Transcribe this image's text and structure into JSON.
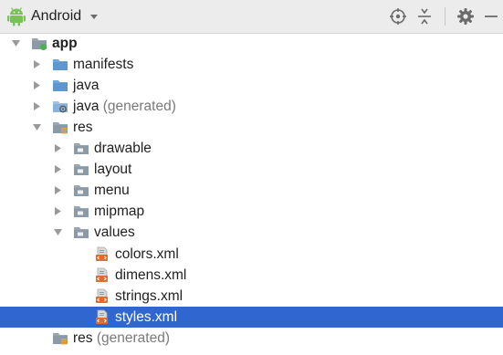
{
  "toolbar": {
    "view_label": "Android",
    "icons": [
      "android-icon",
      "chevron-down-icon",
      "locate-icon",
      "collapse-all-icon",
      "gear-icon",
      "minimize-icon"
    ]
  },
  "colors": {
    "selection": "#2f66d0",
    "folder_blue": "#6fa6d8",
    "folder_gray": "#8c9aa8",
    "xml_orange": "#e06b2a",
    "generated_text": "#7a7a7a"
  },
  "tree": {
    "app": {
      "label": "app",
      "state": "expanded"
    },
    "manifests": {
      "label": "manifests",
      "state": "collapsed"
    },
    "java": {
      "label": "java",
      "state": "collapsed"
    },
    "java_generated": {
      "label": "java",
      "suffix": " (generated)",
      "state": "collapsed"
    },
    "res": {
      "label": "res",
      "state": "expanded"
    },
    "drawable": {
      "label": "drawable",
      "state": "collapsed"
    },
    "layout": {
      "label": "layout",
      "state": "collapsed"
    },
    "menu": {
      "label": "menu",
      "state": "collapsed"
    },
    "mipmap": {
      "label": "mipmap",
      "state": "collapsed"
    },
    "values": {
      "label": "values",
      "state": "expanded"
    },
    "colors": {
      "label": "colors.xml"
    },
    "dimens": {
      "label": "dimens.xml"
    },
    "strings": {
      "label": "strings.xml"
    },
    "styles": {
      "label": "styles.xml",
      "selected": true
    },
    "res_generated": {
      "label": "res",
      "suffix": " (generated)"
    }
  }
}
